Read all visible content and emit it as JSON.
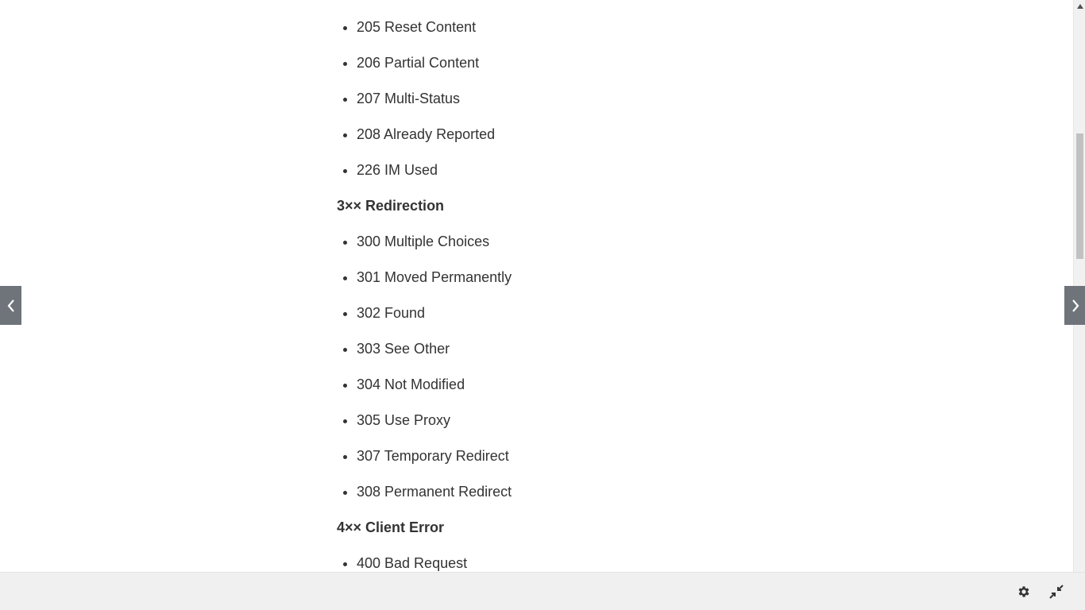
{
  "article": {
    "list_2xx_tail": [
      "205 Reset Content",
      "206 Partial Content",
      "207 Multi-Status",
      "208 Already Reported",
      "226 IM Used"
    ],
    "heading_3xx": "3×× Redirection",
    "list_3xx": [
      "300 Multiple Choices",
      "301 Moved Permanently",
      "302 Found",
      "303 See Other",
      "304 Not Modified",
      "305 Use Proxy",
      "307 Temporary Redirect",
      "308 Permanent Redirect"
    ],
    "heading_4xx": "4×× Client Error",
    "list_4xx": [
      "400 Bad Request"
    ]
  },
  "icons": {
    "prev": "chevron-left-icon",
    "next": "chevron-right-icon",
    "settings": "gear-icon",
    "fullscreen": "exit-fullscreen-icon",
    "scroll_up": "triangle-up-icon"
  },
  "colors": {
    "nav_arrow_bg": "#6e747a",
    "bottom_bar_bg": "#f0f0f0",
    "text": "#333333"
  }
}
